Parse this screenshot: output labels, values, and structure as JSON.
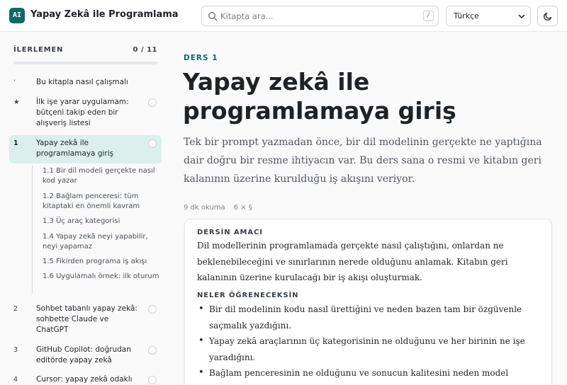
{
  "header": {
    "logo_text": "AI",
    "title": "Yapay Zekâ ile Programlama",
    "search_placeholder": "Kitapta ara...",
    "search_shortcut": "/",
    "language_selected": "Türkçe",
    "theme_icon": "moon-icon"
  },
  "sidebar": {
    "progress_label": "İLERLEMEN",
    "progress_count": "0 / 11",
    "progress_value": 0,
    "items": [
      {
        "num": "·",
        "label": "Bu kitapla nasıl çalışmalı",
        "check": false
      },
      {
        "num": "★",
        "label": "İlk işe yarar uygulamam: bütçeni takip eden bir alışveriş listesi",
        "check": true
      },
      {
        "num": "1",
        "label": "Yapay zekâ ile programlamaya giriş",
        "check": true,
        "active": true
      },
      {
        "num": "2",
        "label": "Sohbet tabanlı yapay zekâ: sohbette Claude ve ChatGPT",
        "check": true
      },
      {
        "num": "3",
        "label": "GitHub Copilot: doğrudan editörde yapay zekâ",
        "check": true
      },
      {
        "num": "4",
        "label": "Cursor: yapay zekâ odaklı",
        "check": true
      }
    ],
    "subitems": [
      "1.1  Bir dil modeli gerçekte nasıl kod yazar",
      "1.2  Bağlam penceresi: tüm kitaptaki en önemli kavram",
      "1.3  Üç araç kategorisi",
      "1.4  Yapay zekâ neyi yapabilir, neyi yapamaz",
      "1.5  Fikirden programa iş akışı",
      "1.6  Uygulamalı örnek: ilk oturum"
    ]
  },
  "main": {
    "eyebrow": "DERS 1",
    "title": "Yapay zekâ ile programlamaya giriş",
    "lead": "Tek bir prompt yazmadan önce, bir dil modelinin gerçekte ne yaptığına dair doğru bir resme ihtiyacın var. Bu ders sana o resmi ve kitabın geri kalanının üzerine kurulduğu iş akışını veriyor.",
    "read_time": "9 dk okuma",
    "sections": "6 × §",
    "card": {
      "goal_heading": "DERSİN AMACI",
      "goal_text": "Dil modellerinin programlamada gerçekte nasıl çalıştığını, onlardan ne beklenebileceğini ve sınırlarının nerede olduğunu anlamak. Kitabın geri kalanının üzerine kurulacağı bir iş akışı oluşturmak.",
      "learn_heading": "NELER ÖĞRENECEKSİN",
      "learn_items": [
        "Bir dil modelinin kodu nasıl ürettiğini ve neden bazen tam bir özgüvenle saçmalık yazdığını.",
        "Yapay zekâ araçlarının üç kategorisinin ne olduğunu ve her birinin ne işe yaradığını.",
        "Bağlam penceresinin ne olduğunu ve sonucun kalitesini neden model seçiminden daha fazla belirlediğini."
      ]
    }
  }
}
